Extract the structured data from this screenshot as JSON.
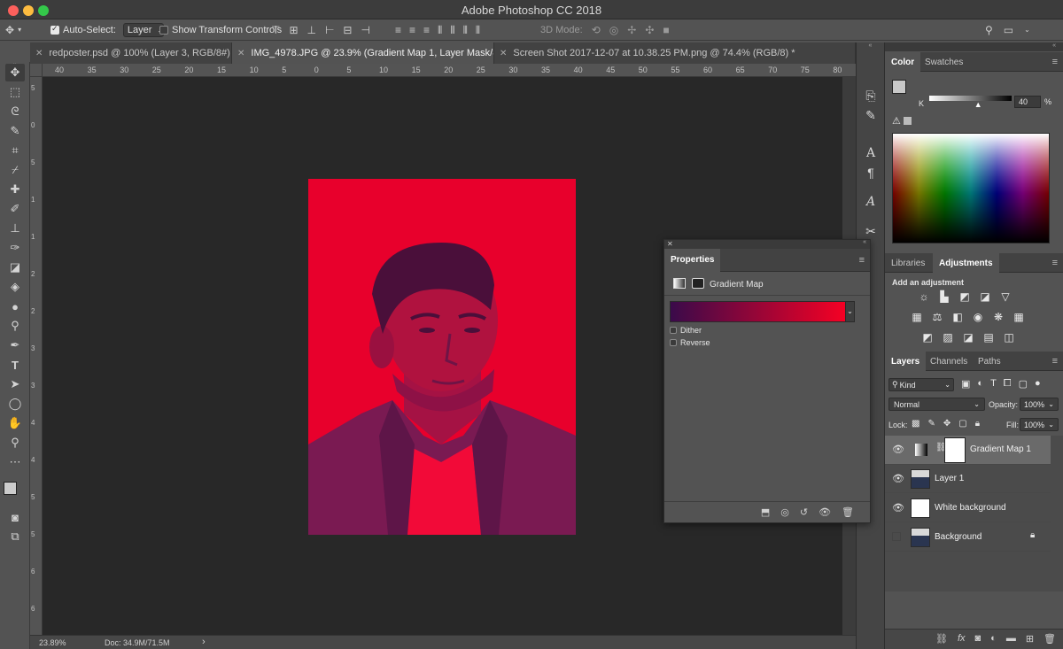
{
  "app": {
    "title": "Adobe Photoshop CC 2018"
  },
  "options_bar": {
    "auto_select_label": "Auto-Select:",
    "auto_select_value": "Layer",
    "show_transform_label": "Show Transform Controls",
    "mode_3d_label": "3D Mode:"
  },
  "tabs": [
    {
      "label": "redposter.psd @ 100% (Layer 3, RGB/8#) *"
    },
    {
      "label": "IMG_4978.JPG @ 23.9% (Gradient Map 1, Layer Mask/8) *"
    },
    {
      "label": "Screen Shot 2017-12-07 at 10.38.25 PM.png @ 74.4% (RGB/8) *"
    }
  ],
  "ruler_h": [
    "40",
    "35",
    "30",
    "25",
    "20",
    "15",
    "10",
    "5",
    "0",
    "5",
    "10",
    "15",
    "20",
    "25",
    "30",
    "35",
    "40",
    "45",
    "50",
    "55",
    "60",
    "65",
    "70",
    "75",
    "80"
  ],
  "ruler_v": [
    "5",
    "0",
    "5",
    "1",
    "1",
    "2",
    "2",
    "3",
    "3",
    "4",
    "4",
    "5",
    "5",
    "6",
    "6"
  ],
  "status": {
    "zoom": "23.89%",
    "doc": "Doc: 34.9M/71.5M"
  },
  "color_panel": {
    "tabs": [
      "Color",
      "Swatches"
    ],
    "slider_label": "K",
    "slider_value": "40",
    "slider_unit": "%",
    "k_level": 0.6
  },
  "adjustments_panel": {
    "tabs": [
      "Libraries",
      "Adjustments"
    ],
    "heading": "Add an adjustment"
  },
  "properties_panel": {
    "title": "Properties",
    "subtitle": "Gradient Map",
    "dither_label": "Dither",
    "reverse_label": "Reverse",
    "gradient_start": "#3a0a4a",
    "gradient_end": "#ff0022"
  },
  "layers_panel": {
    "tabs": [
      "Layers",
      "Channels",
      "Paths"
    ],
    "kind_label": "Kind",
    "blend_mode": "Normal",
    "opacity_label": "Opacity:",
    "opacity_value": "100%",
    "lock_label": "Lock:",
    "fill_label": "Fill:",
    "fill_value": "100%",
    "layers": [
      {
        "name": "Gradient Map 1"
      },
      {
        "name": "Layer 1"
      },
      {
        "name": "White background"
      },
      {
        "name": "Background"
      }
    ]
  },
  "colors": {
    "photo_red": "#e8002c",
    "canvas_bg": "#282828"
  }
}
